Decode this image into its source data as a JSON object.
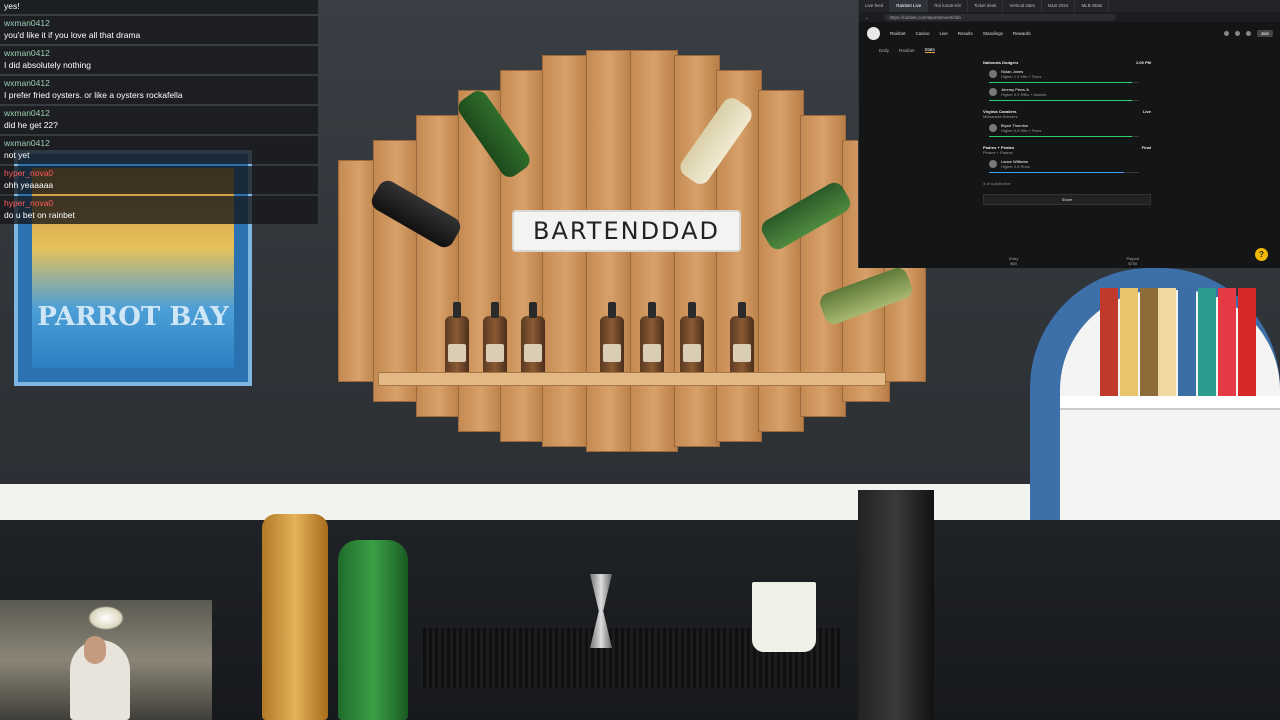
{
  "chat": {
    "top_line": "yes!",
    "messages": [
      {
        "user": "wxman0412",
        "text": "you'd like it if you love all that drama"
      },
      {
        "user": "wxman0412",
        "text": "I did absolutely nothing"
      },
      {
        "user": "wxman0412",
        "text": "I prefer fried oysters. or like a oysters rockafella"
      },
      {
        "user": "wxman0412",
        "text": "did he get 22?"
      },
      {
        "user": "wxman0412",
        "text": "not yet"
      },
      {
        "user": "hyper_nova0",
        "text": "ohh yeaaaaa"
      },
      {
        "user": "hyper_nova0",
        "text": "do u bet on rainbet"
      }
    ]
  },
  "scene": {
    "sign_text": "BARTENDDAD",
    "poster_text": "PARROT BAY"
  },
  "browser": {
    "tabs": [
      "Live feed",
      "Rainbet Live",
      "Roi lunati-Kiit",
      "Ticket desk",
      "Vertical stats",
      "MLB 2024",
      "MLB Stats"
    ],
    "url": "https://rainbet.com/sports/event/mlb",
    "nav": {
      "items": [
        "Rainbet",
        "Casino",
        "Live",
        "Results",
        "Standings",
        "Rewards"
      ],
      "join_label": "Join"
    },
    "subnav": {
      "items": [
        "Daily",
        "Rainbet",
        "Stats"
      ],
      "active": "Stats"
    },
    "panel": {
      "groups": [
        {
          "title": "Nationals Dodgers",
          "right": "1:00 PM",
          "players": [
            {
              "name": "Nolan Jones",
              "sub": "Higher 1.5 Hits + Runs",
              "progress": 0.95
            },
            {
              "name": "Jeremy Pena Jr.",
              "sub": "Higher 0.5 RBIs + Assists",
              "progress": 0.95
            }
          ]
        },
        {
          "title": "Virginia Cavaliers",
          "right": "Live",
          "sub_title": "Milwaukee Brewers",
          "players": [
            {
              "name": "Bryce Thornton",
              "sub": "Higher 0.5 Hits + Runs",
              "progress": 0.95
            }
          ]
        },
        {
          "title": "Padres + Pirates",
          "right": "Final",
          "sub_title": "Pirates + Padres",
          "players": [
            {
              "name": "Lance Williams",
              "sub": "Higher 0.5 Runs",
              "progress": 0.9,
              "color": "blue"
            }
          ]
        }
      ],
      "footnote": "4 of 4 picks live",
      "share_label": "Share"
    },
    "footer": [
      {
        "label": "Entry",
        "value": "$50"
      },
      {
        "label": "Payout",
        "value": "$750"
      }
    ],
    "fab_label": "?"
  }
}
